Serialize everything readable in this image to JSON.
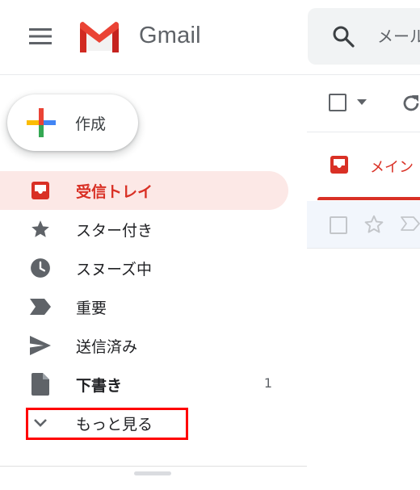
{
  "app": {
    "name": "Gmail"
  },
  "search": {
    "placeholder": "メール"
  },
  "compose": {
    "label": "作成"
  },
  "sidebar": {
    "items": [
      {
        "id": "inbox",
        "label": "受信トレイ",
        "icon": "inbox-icon",
        "active": true
      },
      {
        "id": "starred",
        "label": "スター付き",
        "icon": "star-icon"
      },
      {
        "id": "snoozed",
        "label": "スヌーズ中",
        "icon": "clock-icon"
      },
      {
        "id": "important",
        "label": "重要",
        "icon": "label-important-icon"
      },
      {
        "id": "sent",
        "label": "送信済み",
        "icon": "send-icon"
      },
      {
        "id": "drafts",
        "label": "下書き",
        "icon": "draft-icon",
        "count": "1",
        "bold": true
      },
      {
        "id": "more",
        "label": "もっと見る",
        "icon": "chevron-down-icon"
      }
    ]
  },
  "main": {
    "tabs": [
      {
        "label": "メイン",
        "icon": "inbox-icon",
        "active": true
      }
    ]
  },
  "colors": {
    "accent": "#d93025",
    "active_bg": "#fce8e6",
    "highlight_box": "#ff0000",
    "icon_gray": "#5f6368"
  }
}
